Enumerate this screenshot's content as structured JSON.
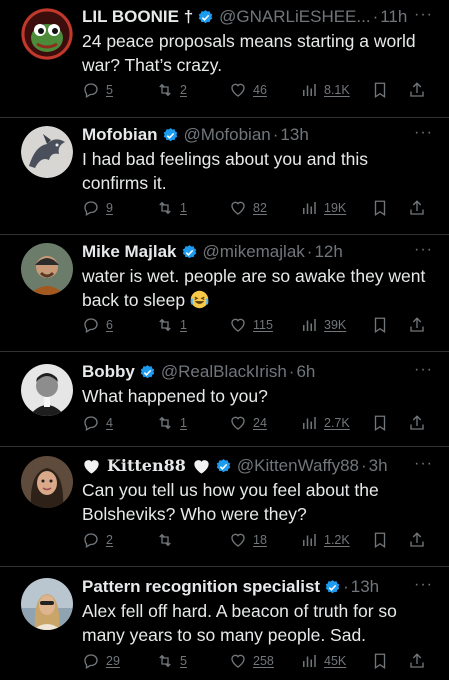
{
  "colors": {
    "background": "#000000",
    "text": "#e7e9ea",
    "muted": "#71767b",
    "verified": "#1d9bf0",
    "divider": "#2f3336"
  },
  "tweets": [
    {
      "name": "LIL BOONIE †",
      "handle": "@GNARLiESHEE...",
      "time": "11h",
      "text": "24 peace proposals means starting a world war? That’s crazy.",
      "replies": "5",
      "retweets": "2",
      "likes": "46",
      "views": "8.1K",
      "avatar": "pepe-frog-avatar"
    },
    {
      "name": "Mofobian",
      "handle": "@Mofobian",
      "time": "13h",
      "text": "I had bad feelings about you and this confirms it.",
      "replies": "9",
      "retweets": "1",
      "likes": "82",
      "views": "19K",
      "avatar": "dragon-avatar"
    },
    {
      "name": "Mike Majlak",
      "handle": "@mikemajlak",
      "time": "12h",
      "text": "water is wet. people are so awake they went back to sleep",
      "emoji": "laughing-face-emoji",
      "replies": "6",
      "retweets": "1",
      "likes": "115",
      "views": "39K",
      "avatar": "man-in-cap-avatar"
    },
    {
      "name": "Bobby",
      "handle": "@RealBlackIrish",
      "time": "6h",
      "text": "What happened to you?",
      "replies": "4",
      "retweets": "1",
      "likes": "24",
      "views": "2.7K",
      "avatar": "man-portrait-avatar"
    },
    {
      "name": "Kitten88",
      "handle": "@KittenWaffy88",
      "time": "3h",
      "text": "Can you tell us how you feel about the Bolsheviks? Who were they?",
      "replies": "2",
      "retweets": "",
      "likes": "18",
      "views": "1.2K",
      "avatar": "woman-avatar"
    },
    {
      "name": "Pattern recognition specialist",
      "handle": "",
      "time": "13h",
      "text": "Alex fell off hard. A beacon of truth for so many years to so many people. Sad.",
      "replies": "29",
      "retweets": "5",
      "likes": "258",
      "views": "45K",
      "avatar": "woman-in-sunglasses-avatar"
    }
  ]
}
